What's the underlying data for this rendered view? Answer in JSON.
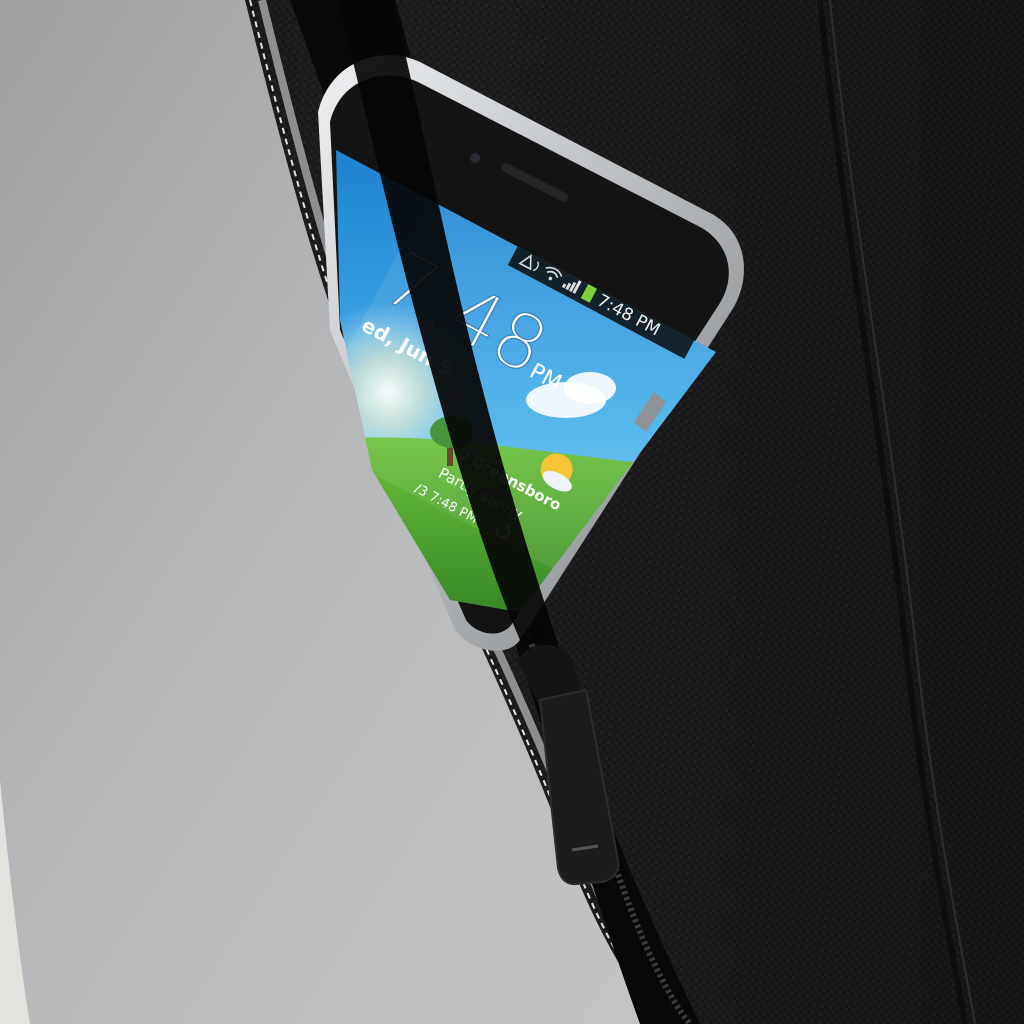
{
  "phone": {
    "status_bar": {
      "time": "7:48 PM",
      "icons": [
        "nfc-icon",
        "wifi-icon",
        "signal-icon",
        "battery-icon"
      ]
    },
    "lock_screen": {
      "time": "7:48",
      "ampm": "PM",
      "date": "ed, Jun 5"
    },
    "weather": {
      "location": "Greensboro",
      "condition": "Partly sunny",
      "updated": "/3 7:48 PM",
      "icons": [
        "location-pin-icon",
        "partly-sunny-icon",
        "refresh-icon"
      ]
    }
  },
  "colors": {
    "bag_black": "#181818",
    "reflective_gray": "#b7b7b7",
    "phone_bezel": "#141414",
    "phone_frame": "#c9cccf",
    "sky_blue": "#3aa2e0",
    "grass_green": "#3f9a2c",
    "sun_yellow": "#f7c535"
  }
}
